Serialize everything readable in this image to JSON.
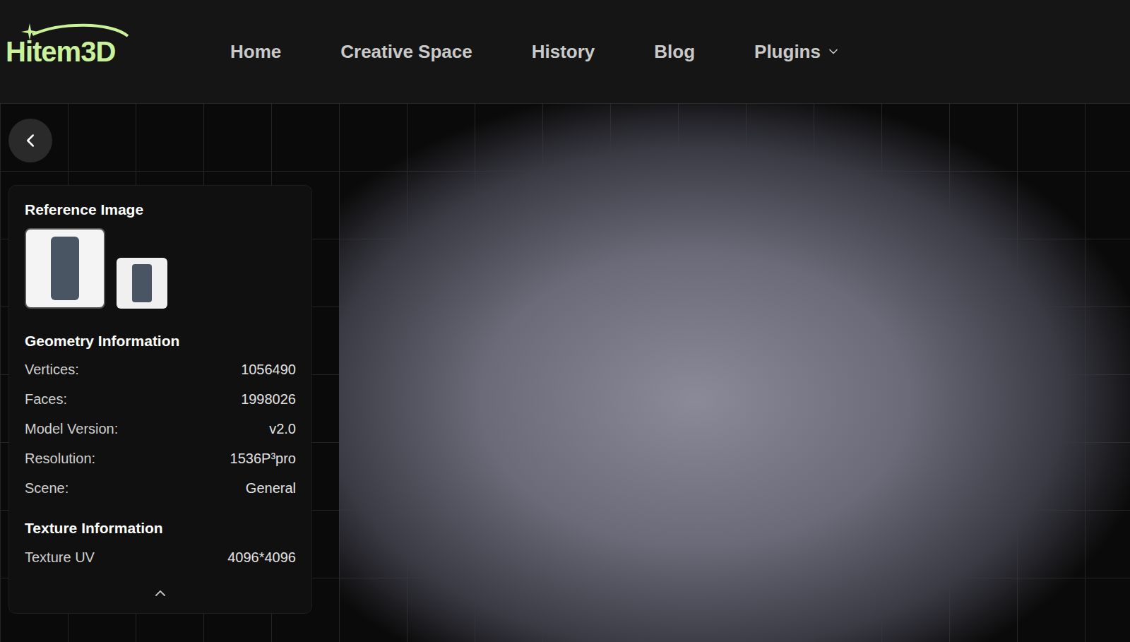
{
  "logo": "Hitem3D",
  "nav": [
    {
      "label": "Home",
      "dropdown": false
    },
    {
      "label": "Creative Space",
      "dropdown": false
    },
    {
      "label": "History",
      "dropdown": false
    },
    {
      "label": "Blog",
      "dropdown": false
    },
    {
      "label": "Plugins",
      "dropdown": true
    }
  ],
  "info_panel": {
    "expanded": true,
    "reference_image": {
      "title": "Reference Image",
      "images": [
        {
          "selected": true
        },
        {
          "selected": false
        }
      ]
    },
    "geometry": {
      "title": "Geometry Information",
      "rows": [
        {
          "label": "Vertices:",
          "value": "1056490"
        },
        {
          "label": "Faces:",
          "value": "1998026"
        },
        {
          "label": "Model Version:",
          "value": "v2.0"
        },
        {
          "label": "Resolution:",
          "value": "1536P³pro"
        },
        {
          "label": "Scene:",
          "value": "General"
        }
      ]
    },
    "texture": {
      "title": "Texture Information",
      "rows": [
        {
          "label": "Texture UV",
          "value": "4096*4096"
        }
      ]
    }
  }
}
